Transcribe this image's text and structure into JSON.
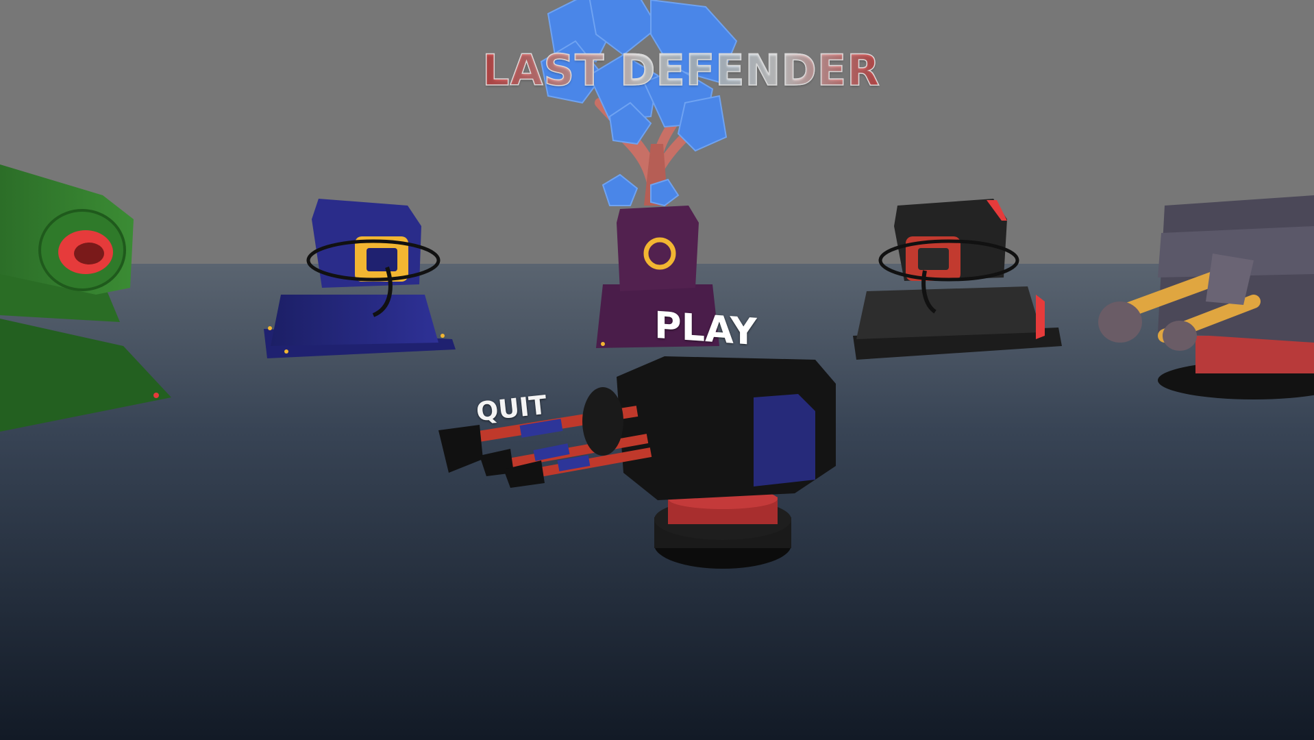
{
  "menu": {
    "title": "LAST DEFENDER",
    "play_label": "PLAY",
    "quit_label": "QUIT"
  },
  "colors": {
    "sky": "#777777",
    "floor_top": "#5a6470",
    "floor_bottom": "#121a26",
    "tree_leaves": "#4a86e8",
    "tree_trunk": "#c87066",
    "accent_red": "#e63b3b",
    "accent_yellow": "#f2b632"
  },
  "scene_objects": [
    {
      "name": "green-turret",
      "color": "#2f7a2a"
    },
    {
      "name": "blue-turret",
      "color": "#23257a"
    },
    {
      "name": "purple-turret",
      "color": "#4a1d4a"
    },
    {
      "name": "black-red-turret",
      "color": "#222222"
    },
    {
      "name": "grey-double-barrel-turret",
      "color": "#4b4858"
    },
    {
      "name": "gatling-turret",
      "color": "#151515"
    }
  ]
}
